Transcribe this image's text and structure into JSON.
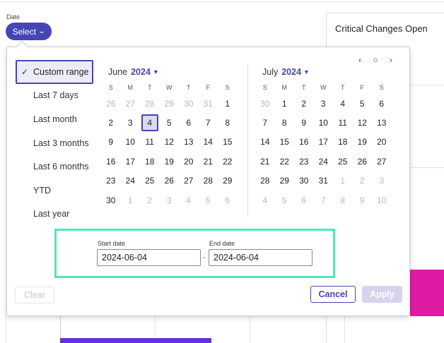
{
  "card": {
    "title": "Critical Changes Open"
  },
  "date_filter": {
    "label": "Date",
    "select_label": "Select"
  },
  "presets": [
    {
      "label": "Custom range",
      "active": true
    },
    {
      "label": "Last 7 days"
    },
    {
      "label": "Last month"
    },
    {
      "label": "Last 3 months"
    },
    {
      "label": "Last 6 months"
    },
    {
      "label": "YTD"
    },
    {
      "label": "Last year"
    }
  ],
  "weekdays": [
    "S",
    "M",
    "T",
    "W",
    "T",
    "F",
    "S"
  ],
  "calendars": [
    {
      "month": "June",
      "year": "2024",
      "weeks": [
        [
          [
            "26",
            0
          ],
          [
            "27",
            0
          ],
          [
            "28",
            0
          ],
          [
            "29",
            0
          ],
          [
            "30",
            0
          ],
          [
            "31",
            0
          ],
          [
            "1",
            1
          ]
        ],
        [
          [
            "2",
            1
          ],
          [
            "3",
            1
          ],
          [
            "4",
            1,
            "selected"
          ],
          [
            "5",
            1
          ],
          [
            "6",
            1
          ],
          [
            "7",
            1
          ],
          [
            "8",
            1
          ]
        ],
        [
          [
            "9",
            1
          ],
          [
            "10",
            1
          ],
          [
            "11",
            1
          ],
          [
            "12",
            1
          ],
          [
            "13",
            1
          ],
          [
            "14",
            1
          ],
          [
            "15",
            1
          ]
        ],
        [
          [
            "16",
            1
          ],
          [
            "17",
            1
          ],
          [
            "18",
            1
          ],
          [
            "19",
            1
          ],
          [
            "20",
            1
          ],
          [
            "21",
            1
          ],
          [
            "22",
            1
          ]
        ],
        [
          [
            "23",
            1
          ],
          [
            "24",
            1
          ],
          [
            "25",
            1
          ],
          [
            "26",
            1
          ],
          [
            "27",
            1
          ],
          [
            "28",
            1
          ],
          [
            "29",
            1
          ]
        ],
        [
          [
            "30",
            1
          ],
          [
            "1",
            0
          ],
          [
            "2",
            0
          ],
          [
            "3",
            0
          ],
          [
            "4",
            0
          ],
          [
            "5",
            0
          ],
          [
            "6",
            0
          ]
        ]
      ]
    },
    {
      "month": "July",
      "year": "2024",
      "weeks": [
        [
          [
            "30",
            0
          ],
          [
            "1",
            1
          ],
          [
            "2",
            1
          ],
          [
            "3",
            1
          ],
          [
            "4",
            1
          ],
          [
            "5",
            1
          ],
          [
            "6",
            1
          ]
        ],
        [
          [
            "7",
            1
          ],
          [
            "8",
            1
          ],
          [
            "9",
            1
          ],
          [
            "10",
            1
          ],
          [
            "11",
            1
          ],
          [
            "12",
            1
          ],
          [
            "13",
            1
          ]
        ],
        [
          [
            "14",
            1
          ],
          [
            "15",
            1
          ],
          [
            "16",
            1
          ],
          [
            "17",
            1
          ],
          [
            "18",
            1
          ],
          [
            "19",
            1
          ],
          [
            "20",
            1
          ]
        ],
        [
          [
            "21",
            1
          ],
          [
            "22",
            1
          ],
          [
            "23",
            1
          ],
          [
            "24",
            1
          ],
          [
            "25",
            1
          ],
          [
            "26",
            1
          ],
          [
            "27",
            1
          ]
        ],
        [
          [
            "28",
            1
          ],
          [
            "29",
            1
          ],
          [
            "30",
            1
          ],
          [
            "31",
            1
          ],
          [
            "1",
            0
          ],
          [
            "2",
            0
          ],
          [
            "3",
            0
          ]
        ],
        [
          [
            "4",
            0
          ],
          [
            "5",
            0
          ],
          [
            "6",
            0
          ],
          [
            "7",
            0
          ],
          [
            "8",
            0
          ],
          [
            "9",
            0
          ],
          [
            "10",
            0
          ]
        ]
      ]
    }
  ],
  "nav": {
    "prev": "‹",
    "today": "○",
    "next": "›"
  },
  "range": {
    "start_label": "Start date",
    "start_value": "2024-06-04",
    "end_label": "End date",
    "end_value": "2024-06-04",
    "separator": "-"
  },
  "actions": {
    "clear": "Clear",
    "cancel": "Cancel",
    "apply": "Apply"
  },
  "colors": {
    "accent": "#4546b4",
    "highlight_border": "#53e6b3",
    "bar_pink": "#e01aa4",
    "bar_purple": "#6a2fd8"
  }
}
